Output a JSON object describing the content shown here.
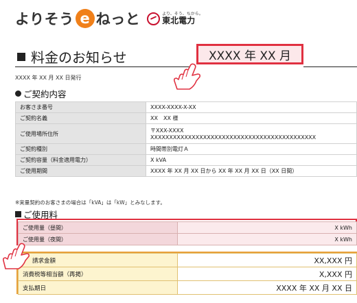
{
  "header": {
    "logo_pre": "よりそう",
    "logo_letter": "e",
    "logo_post": "ねっと",
    "brand_sub": "より、そう、ちから。",
    "brand_name": "東北電力"
  },
  "title": "料金のお知らせ",
  "billing_month": "XXXX 年  XX 月",
  "issue_date": "XXXX 年 XX 月 XX 日発行",
  "contract": {
    "heading": "ご契約内容",
    "rows": [
      {
        "label": "お客さま番号",
        "value": "XXXX-XXXX-X-XX"
      },
      {
        "label": "ご契約名義",
        "value": "XX　XX 様"
      },
      {
        "label": "ご使用場所住所",
        "value": "〒XXX-XXXX",
        "value2": "XXXXXXXXXXXXXXXXXXXXXXXXXXXXXXXXXXXXXXXXXXXX"
      },
      {
        "label": "ご契約種別",
        "value": "時間帯別電灯Ａ"
      },
      {
        "label": "ご契約容量（料金適用電力）",
        "value": "X kVA"
      },
      {
        "label": "ご使用期間",
        "value": "XXXX 年 XX 月 XX 日から XX 年 XX 月 XX 日（XX 日間）"
      }
    ],
    "note": "※実量契約のお客さまの場合は「kVA」は「kW」とみなします。"
  },
  "usage": {
    "heading": "ご使用料",
    "rows": [
      {
        "label": "ご使用量（昼間）",
        "value": "X kWh"
      },
      {
        "label": "ご使用量（夜間）",
        "value": "X kWh"
      }
    ]
  },
  "billing": {
    "rows": [
      {
        "label": "請求金額",
        "value": "XX,XXX 円"
      },
      {
        "label": "消費税等相当額（再掲）",
        "value": "X,XXX 円"
      },
      {
        "label": "支払期日",
        "value": "XXXX 年 XX 月 XX 日"
      }
    ]
  },
  "colors": {
    "highlight_red": "#e03040",
    "highlight_orange": "#e8a03a",
    "logo_orange": "#f0801a"
  },
  "icons": [
    "pointing-hand-icon",
    "tohoku-electric-logo-icon"
  ]
}
